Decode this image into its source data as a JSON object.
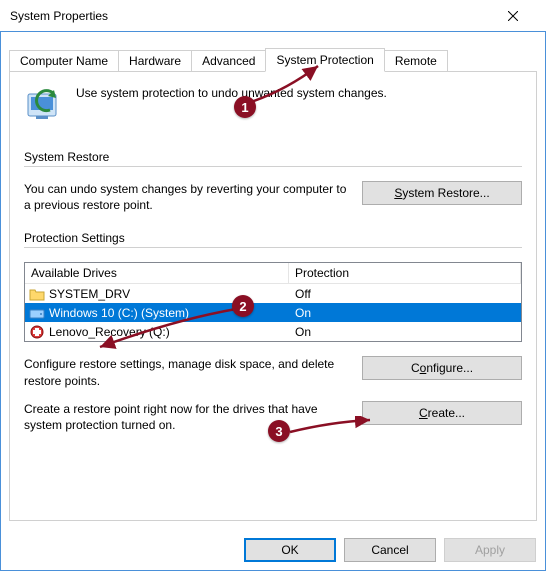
{
  "window": {
    "title": "System Properties"
  },
  "tabs": {
    "computer_name": "Computer Name",
    "hardware": "Hardware",
    "advanced": "Advanced",
    "system_protection": "System Protection",
    "remote": "Remote"
  },
  "intro": "Use system protection to undo unwanted system changes.",
  "system_restore": {
    "label": "System Restore",
    "desc": "You can undo system changes by reverting your computer to a previous restore point.",
    "button": "System Restore..."
  },
  "protection_settings": {
    "label": "Protection Settings",
    "columns": {
      "drives": "Available Drives",
      "protection": "Protection"
    },
    "rows": [
      {
        "name": "SYSTEM_DRV",
        "protection": "Off",
        "icon": "folder",
        "selected": false
      },
      {
        "name": "Windows 10 (C:) (System)",
        "protection": "On",
        "icon": "drive",
        "selected": true
      },
      {
        "name": "Lenovo_Recovery (Q:)",
        "protection": "On",
        "icon": "recovery",
        "selected": false
      }
    ],
    "configure_desc": "Configure restore settings, manage disk space, and delete restore points.",
    "configure_button": "Configure...",
    "create_desc": "Create a restore point right now for the drives that have system protection turned on.",
    "create_button": "Create..."
  },
  "buttons": {
    "ok": "OK",
    "cancel": "Cancel",
    "apply": "Apply"
  },
  "annotations": {
    "n1": "1",
    "n2": "2",
    "n3": "3"
  }
}
